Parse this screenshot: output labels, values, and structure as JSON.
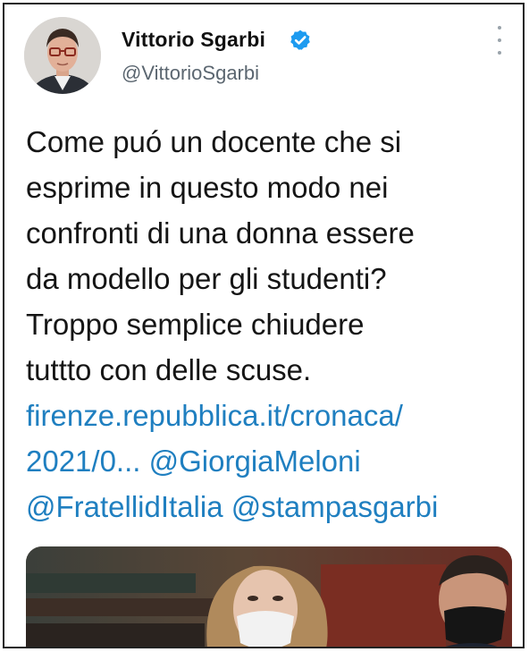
{
  "tweet": {
    "author_name": "Vittorio Sgarbi",
    "author_handle": "@VittorioSgarbi",
    "verified": true,
    "text_lines": [
      "Come puó un docente che si",
      "esprime in questo modo nei",
      "confronti di una donna essere",
      "da modello per gli studenti?",
      "Troppo semplice chiudere",
      "tuttto con delle scuse."
    ],
    "link_line_1": "firenze.repubblica.it/cronaca/",
    "link_line_2_url": "2021/0...",
    "mention_giorgia": "@GiorgiaMeloni",
    "mention_fratelli": "@FratellidItalia",
    "mention_stampa": "@stampasgarbi"
  },
  "colors": {
    "link": "#1f7fc0",
    "verified_badge": "#1d9bf0",
    "handle": "#5b6670",
    "text": "#151515"
  },
  "icons": {
    "verified": "verified-badge-icon",
    "more": "more-vertical-icon"
  }
}
